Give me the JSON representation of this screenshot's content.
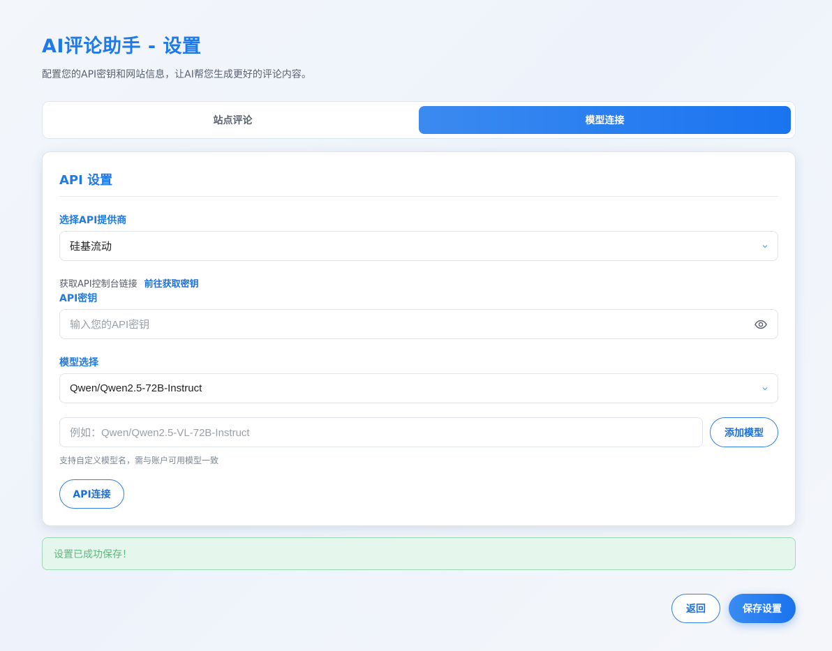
{
  "header": {
    "title": "AI评论助手 - 设置",
    "subtitle": "配置您的API密钥和网站信息，让AI帮您生成更好的评论内容。"
  },
  "tabs": [
    {
      "label": "站点评论",
      "active": false
    },
    {
      "label": "模型连接",
      "active": true
    }
  ],
  "api_settings": {
    "section_title": "API 设置",
    "provider": {
      "label": "选择API提供商",
      "selected": "硅基流动"
    },
    "console_link": {
      "text": "获取API控制台链接",
      "link_text": "前往获取密钥"
    },
    "api_key": {
      "label": "API密钥",
      "value": "",
      "placeholder": "输入您的API密钥"
    },
    "model": {
      "label": "模型选择",
      "selected": "Qwen/Qwen2.5-72B-Instruct"
    },
    "custom_model": {
      "value": "",
      "placeholder": "例如：Qwen/Qwen2.5-VL-72B-Instruct",
      "add_button": "添加模型",
      "hint": "支持自定义模型名，需与账户可用模型一致"
    },
    "connect_button": "API连接"
  },
  "alert": {
    "message": "设置已成功保存！"
  },
  "footer": {
    "back_button": "返回",
    "save_button": "保存设置"
  },
  "colors": {
    "accent": "#1f7ae8",
    "success_text": "#5bb87c",
    "success_bg": "#e5f6ec"
  }
}
